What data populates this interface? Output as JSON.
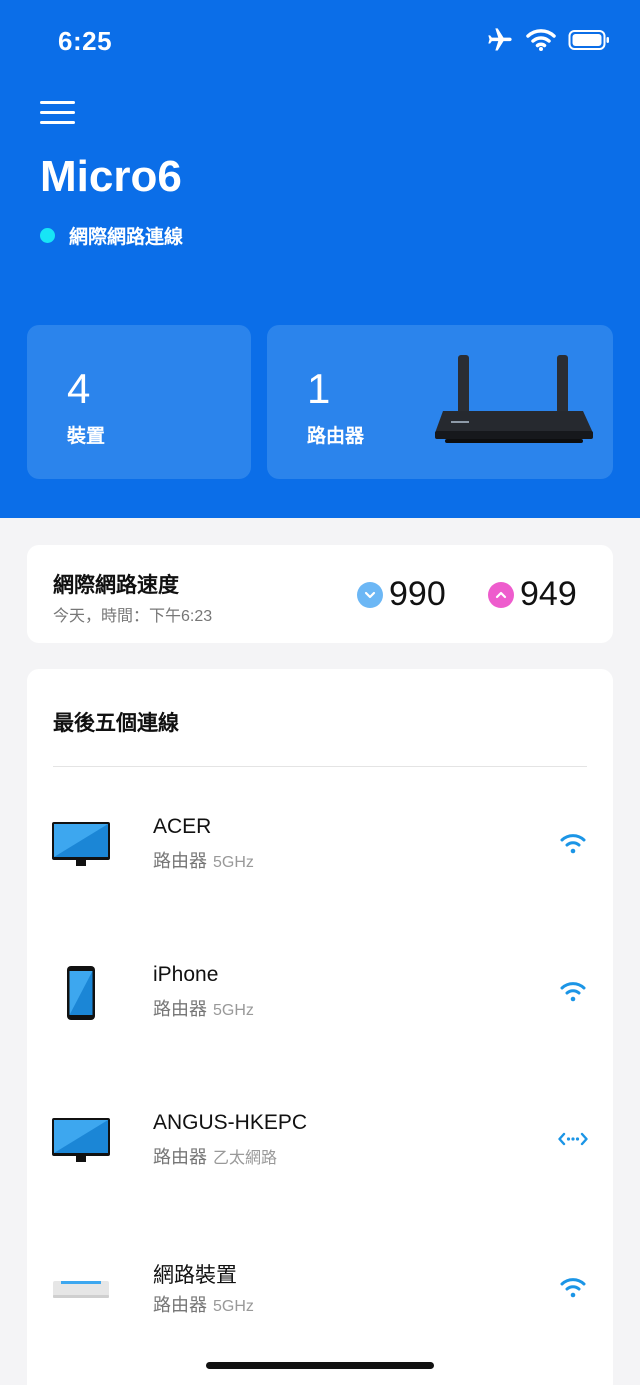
{
  "status_bar": {
    "time": "6:25"
  },
  "header": {
    "network_name": "Micro6",
    "status_text": "網際網路連線",
    "status_color": "#17e5f6",
    "background": "#0b6ee8"
  },
  "cards": {
    "devices": {
      "count": "4",
      "label": "裝置"
    },
    "routers": {
      "count": "1",
      "label": "路由器"
    }
  },
  "speed": {
    "title": "網際網路速度",
    "timestamp": "今天，時間：下午6:23",
    "download": "990",
    "upload": "949",
    "download_color": "#6cb7f5",
    "upload_color": "#ee5ccd"
  },
  "connections": {
    "title": "最後五個連線",
    "items": [
      {
        "name": "ACER",
        "parent": "路由器",
        "band": "5GHz",
        "device_icon": "monitor-icon",
        "conn_icon": "wifi-icon"
      },
      {
        "name": "iPhone",
        "parent": "路由器",
        "band": "5GHz",
        "device_icon": "phone-icon",
        "conn_icon": "wifi-icon"
      },
      {
        "name": "ANGUS-HKEPC",
        "parent": "路由器",
        "band": "乙太網路",
        "device_icon": "monitor-icon",
        "conn_icon": "ethernet-icon"
      },
      {
        "name": "網路裝置",
        "parent": "路由器",
        "band": "5GHz",
        "device_icon": "network-device-icon",
        "conn_icon": "wifi-icon"
      }
    ]
  }
}
